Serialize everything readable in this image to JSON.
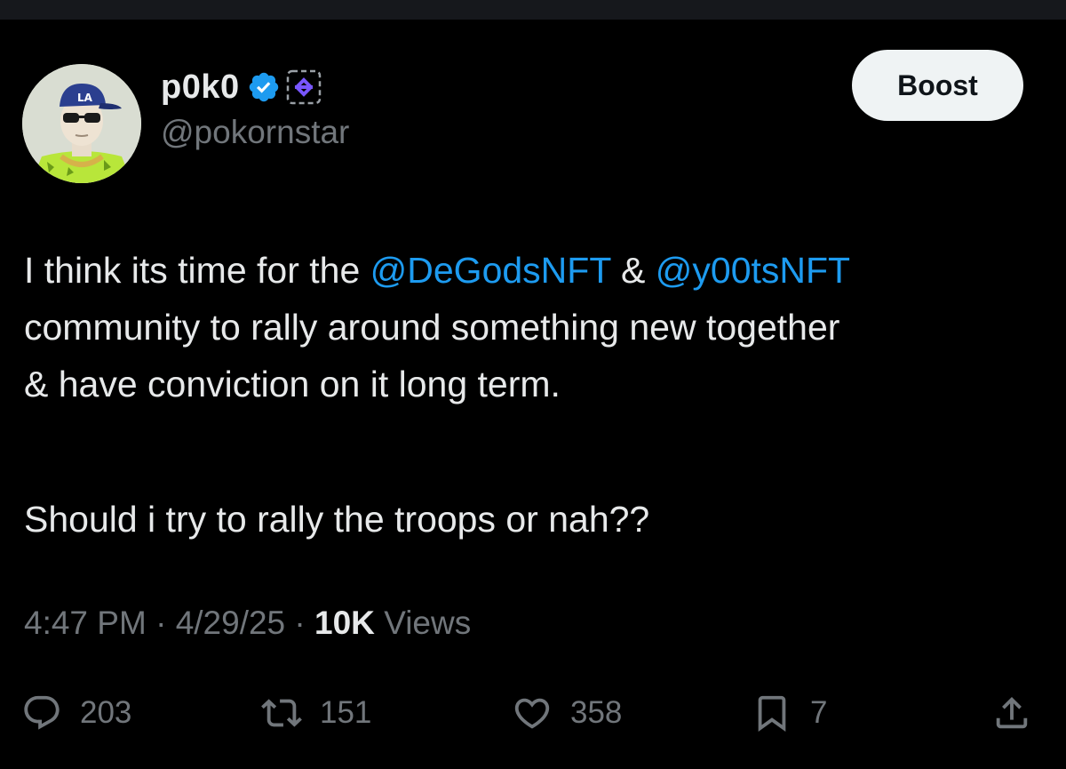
{
  "author": {
    "display_name": "p0k0",
    "handle": "@pokornstar",
    "avatar_icon": "avatar-image",
    "verified_icon": "verified-badge-icon",
    "affiliate_icon": "affiliate-badge-icon"
  },
  "boost_button": {
    "label": "Boost"
  },
  "tweet": {
    "line1_prefix": "I think its time for the ",
    "mention1": "@DeGodsNFT",
    "line1_middle": " & ",
    "mention2": "@y00tsNFT",
    "line2": "community to rally around something new together",
    "line3": "& have conviction on it long term.",
    "line4": "Should i try to rally the troops or nah??"
  },
  "meta": {
    "time": "4:47 PM",
    "sep1": " · ",
    "date": "4/29/25",
    "sep2": " · ",
    "views_count": "10K",
    "views_label": " Views"
  },
  "actions": {
    "replies": "203",
    "reposts": "151",
    "likes": "358",
    "bookmarks": "7"
  },
  "colors": {
    "background": "#000000",
    "text": "#e7e9ea",
    "secondary": "#71767b",
    "mention": "#1d9bf0",
    "verified": "#1d9bf0",
    "affiliate": "#7856ff",
    "boost_bg": "#eff3f4"
  }
}
